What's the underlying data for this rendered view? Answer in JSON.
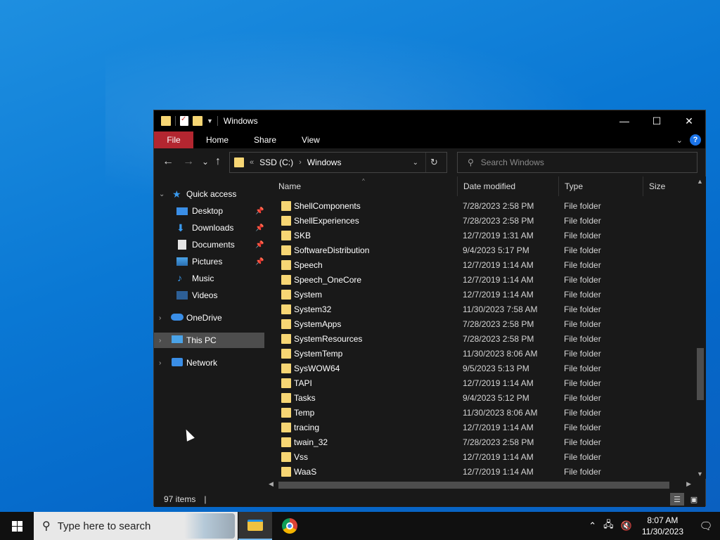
{
  "window": {
    "title": "Windows",
    "controls": {
      "minimize": "—",
      "maximize": "☐",
      "close": "✕"
    }
  },
  "ribbon": {
    "tabs": [
      {
        "label": "File"
      },
      {
        "label": "Home"
      },
      {
        "label": "Share"
      },
      {
        "label": "View"
      }
    ],
    "expand_icon": "chevron-down-icon",
    "help_label": "?"
  },
  "navbar": {
    "back": "←",
    "forward": "→",
    "recent": "⌄",
    "up": "↑",
    "address": {
      "overflow": "«",
      "crumbs": [
        "SSD (C:)",
        "Windows"
      ],
      "separator": "›"
    },
    "refresh": "↻",
    "search": {
      "placeholder": "Search Windows"
    }
  },
  "navpane": {
    "quick_access": "Quick access",
    "items": [
      {
        "label": "Desktop",
        "icon": "desktop-icon",
        "pinned": true
      },
      {
        "label": "Downloads",
        "icon": "downloads-icon",
        "pinned": true
      },
      {
        "label": "Documents",
        "icon": "documents-icon",
        "pinned": true
      },
      {
        "label": "Pictures",
        "icon": "pictures-icon",
        "pinned": true
      },
      {
        "label": "Music",
        "icon": "music-icon",
        "pinned": false
      },
      {
        "label": "Videos",
        "icon": "videos-icon",
        "pinned": false
      }
    ],
    "onedrive": "OneDrive",
    "this_pc": "This PC",
    "network": "Network",
    "selected": "This PC"
  },
  "columns": {
    "name": "Name",
    "date": "Date modified",
    "type": "Type",
    "size": "Size"
  },
  "files": [
    {
      "name": "ShellComponents",
      "date": "7/28/2023 2:58 PM",
      "type": "File folder"
    },
    {
      "name": "ShellExperiences",
      "date": "7/28/2023 2:58 PM",
      "type": "File folder"
    },
    {
      "name": "SKB",
      "date": "12/7/2019 1:31 AM",
      "type": "File folder"
    },
    {
      "name": "SoftwareDistribution",
      "date": "9/4/2023 5:17 PM",
      "type": "File folder"
    },
    {
      "name": "Speech",
      "date": "12/7/2019 1:14 AM",
      "type": "File folder"
    },
    {
      "name": "Speech_OneCore",
      "date": "12/7/2019 1:14 AM",
      "type": "File folder"
    },
    {
      "name": "System",
      "date": "12/7/2019 1:14 AM",
      "type": "File folder"
    },
    {
      "name": "System32",
      "date": "11/30/2023 7:58 AM",
      "type": "File folder"
    },
    {
      "name": "SystemApps",
      "date": "7/28/2023 2:58 PM",
      "type": "File folder"
    },
    {
      "name": "SystemResources",
      "date": "7/28/2023 2:58 PM",
      "type": "File folder"
    },
    {
      "name": "SystemTemp",
      "date": "11/30/2023 8:06 AM",
      "type": "File folder"
    },
    {
      "name": "SysWOW64",
      "date": "9/5/2023 5:13 PM",
      "type": "File folder"
    },
    {
      "name": "TAPI",
      "date": "12/7/2019 1:14 AM",
      "type": "File folder"
    },
    {
      "name": "Tasks",
      "date": "9/4/2023 5:12 PM",
      "type": "File folder"
    },
    {
      "name": "Temp",
      "date": "11/30/2023 8:06 AM",
      "type": "File folder"
    },
    {
      "name": "tracing",
      "date": "12/7/2019 1:14 AM",
      "type": "File folder"
    },
    {
      "name": "twain_32",
      "date": "7/28/2023 2:58 PM",
      "type": "File folder"
    },
    {
      "name": "Vss",
      "date": "12/7/2019 1:14 AM",
      "type": "File folder"
    },
    {
      "name": "WaaS",
      "date": "12/7/2019 1:14 AM",
      "type": "File folder"
    }
  ],
  "status": {
    "count": "97 items",
    "separator": "|"
  },
  "taskbar": {
    "search_placeholder": "Type here to search",
    "apps": [
      "file-explorer-icon",
      "chrome-icon"
    ],
    "clock": {
      "time": "8:07 AM",
      "date": "11/30/2023"
    }
  },
  "colors": {
    "accent": "#1a73e8",
    "file_tab": "#b32630",
    "folder": "#f7d674",
    "selected": "#4d4d4d"
  }
}
